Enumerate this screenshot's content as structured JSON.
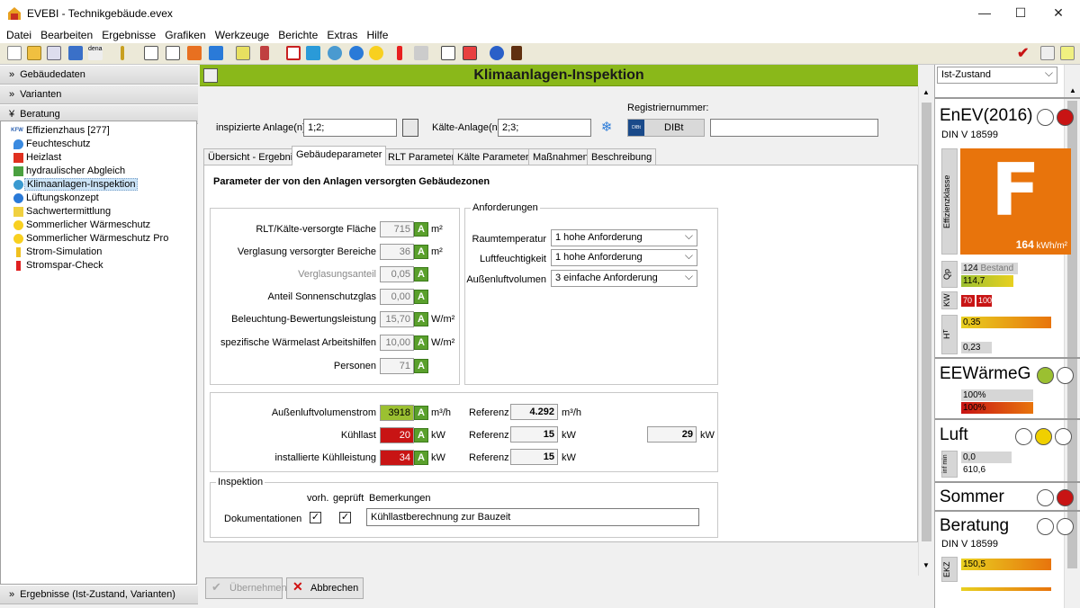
{
  "window": {
    "title": "EVEBI - Technikgebäude.evex",
    "minimize": "—",
    "maximize": "☐",
    "close": "✕"
  },
  "menu": [
    "Datei",
    "Bearbeiten",
    "Ergebnisse",
    "Grafiken",
    "Werkzeuge",
    "Berichte",
    "Extras",
    "Hilfe"
  ],
  "sidebar": {
    "sections": [
      {
        "label": "Gebäudedaten"
      },
      {
        "label": "Varianten"
      },
      {
        "label": "Beratung"
      }
    ],
    "items": [
      {
        "label": "Effizienzhaus [277]",
        "icon": "kfw-icon",
        "icon_text": "KFW"
      },
      {
        "label": "Feuchteschutz",
        "icon": "drop-icon"
      },
      {
        "label": "Heizlast",
        "icon": "heat-icon"
      },
      {
        "label": "hydraulischer Abgleich",
        "icon": "grid-icon"
      },
      {
        "label": "Klimaanlagen-Inspektion",
        "icon": "fan-icon"
      },
      {
        "label": "Lüftungskonzept",
        "icon": "fan-icon"
      },
      {
        "label": "Sachwertermittlung",
        "icon": "house-icon"
      },
      {
        "label": "Sommerlicher Wärmeschutz",
        "icon": "sun-icon"
      },
      {
        "label": "Sommerlicher Wärmeschutz Pro",
        "icon": "sun-icon"
      },
      {
        "label": "Strom-Simulation",
        "icon": "bolt-icon"
      },
      {
        "label": "Stromspar-Check",
        "icon": "plug-icon"
      }
    ],
    "footer": "Ergebnisse (Ist-Zustand, Varianten)"
  },
  "header": {
    "title": "Klimaanlagen-Inspektion"
  },
  "top": {
    "inspizierte_label": "inspizierte Anlage(n)",
    "inspizierte_value": "1;2;",
    "kaelte_label": "Kälte-Anlage(n)",
    "kaelte_value": "2;3;",
    "reg_label": "Registriernummer:",
    "dibt_badge": "DIBt",
    "dibt_label": "DIBt",
    "reg_value": ""
  },
  "tabs": [
    "Übersicht - Ergebnis",
    "Gebäudeparameter",
    "RLT Parameter",
    "Kälte Parameter",
    "Maßnahmen",
    "Beschreibung"
  ],
  "page": {
    "title": "Parameter der von den Anlagen versorgten Gebäudezonen",
    "params": [
      {
        "label": "RLT/Kälte-versorgte Fläche",
        "value": "715",
        "unit": "m²"
      },
      {
        "label": "Verglasung versorgter Bereiche",
        "value": "36",
        "unit": "m²"
      },
      {
        "label": "Verglasungsanteil",
        "value": "0,05",
        "unit": ""
      },
      {
        "label": "Anteil Sonnenschutzglas",
        "value": "0,00",
        "unit": ""
      },
      {
        "label": "Beleuchtung-Bewertungsleistung",
        "value": "15,70",
        "unit": "W/m²"
      },
      {
        "label": "spezifische Wärmelast Arbeitshilfen",
        "value": "10,00",
        "unit": "W/m²"
      },
      {
        "label": "Personen",
        "value": "71",
        "unit": ""
      }
    ],
    "a_label": "A",
    "anforderungen": {
      "title": "Anforderungen",
      "rows": [
        {
          "label": "Raumtemperatur",
          "value": "1 hohe Anforderung"
        },
        {
          "label": "Luftfeuchtigkeit",
          "value": "1 hohe Anforderung"
        },
        {
          "label": "Außenluftvolumen",
          "value": "3 einfache Anforderung"
        }
      ]
    },
    "results": [
      {
        "label": "Außenluftvolumenstrom",
        "value": "3918",
        "unit": "m³/h",
        "color": "#9bc031",
        "ref_label": "Referenz",
        "ref": "4.292",
        "ref_unit": "m³/h"
      },
      {
        "label": "Kühllast",
        "value": "20",
        "unit": "kW",
        "color": "#c81414",
        "ref_label": "Referenz",
        "ref": "15",
        "ref_unit": "kW"
      },
      {
        "label": "installierte Kühlleistung",
        "value": "34",
        "unit": "kW",
        "color": "#c81414",
        "ref_label": "Referenz",
        "ref": "15",
        "ref_unit": "kW"
      }
    ],
    "extra": {
      "value": "29",
      "unit": "kW"
    },
    "inspektion": {
      "title": "Inspektion",
      "col_vorh": "vorh.",
      "col_geprueft": "geprüft",
      "col_bem": "Bemerkungen",
      "row_label": "Dokumentationen",
      "check": "✓",
      "remark": "Kühllastberechnung zur Bauzeit"
    }
  },
  "buttons": {
    "apply": "Übernehmen",
    "cancel": "Abbrechen"
  },
  "right": {
    "dropdown": "Ist-Zustand",
    "enev": {
      "title": "EnEV(2016)",
      "sub": "DIN V 18599",
      "class_label": "Effizienzklasse",
      "class": "F",
      "kwh": "164",
      "kwh_unit": "kWh/m²",
      "qp_label": "Qp",
      "qp_ref": "124",
      "qp_ref_label": "Bestand",
      "qp_val": "114,7",
      "kw_label": "KW",
      "kw1": "70",
      "kw2": "100",
      "ht_label": "H",
      "ht_sub": "T",
      "ht1": "0,35",
      "ht2": "0,23"
    },
    "ee": {
      "title": "EEWärmeG",
      "v1": "100%",
      "v2": "100%"
    },
    "luft": {
      "title": "Luft",
      "side": "inf min",
      "v1": "0,0",
      "v2": "610,6"
    },
    "sommer": {
      "title": "Sommer"
    },
    "beratung": {
      "title": "Beratung",
      "sub": "DIN V 18599",
      "ekz_label": "EKZ",
      "ekz": "150,5"
    }
  },
  "colors": {
    "accent": "#8ab81a",
    "red": "#c81414",
    "orange": "#e8740c",
    "green": "#9bc031",
    "yellow": "#f0d000"
  }
}
